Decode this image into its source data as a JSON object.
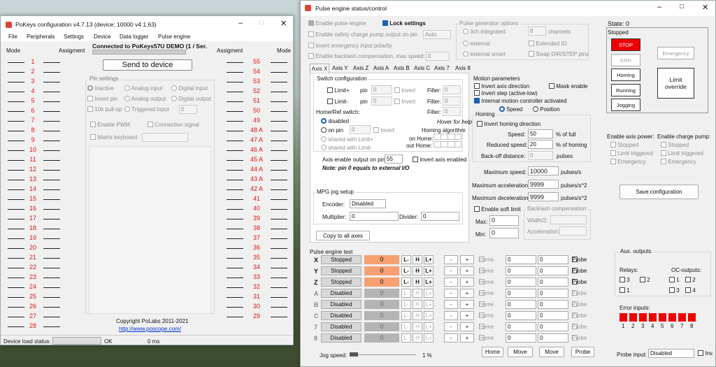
{
  "left": {
    "title": "PoKeys configuration v4.7.13 (device: 10000 v4.1.63)",
    "menu": [
      "File",
      "Peripherals",
      "Settings",
      "Device",
      "Data logger",
      "Pulse engine"
    ],
    "connected": "Connected to PoKeys57U DEMO (1 / Ser.",
    "send": "Send to device",
    "mode_l": "Mode",
    "assign_l": "Assigment",
    "assign_r": "Assigment",
    "mode_r": "Mode",
    "left_pins": [
      "1",
      "2",
      "3",
      "4",
      "5",
      "6",
      "7",
      "8",
      "9",
      "10",
      "11",
      "12",
      "13",
      "14",
      "15",
      "16",
      "17",
      "18",
      "19",
      "20",
      "21",
      "22",
      "23",
      "24",
      "25",
      "26",
      "27",
      "28"
    ],
    "right_pins": [
      "55",
      "54",
      "53",
      "52",
      "51",
      "50",
      "49",
      "48 A",
      "47 A",
      "46 A",
      "45 A",
      "44 A",
      "43 A",
      "42 A",
      "41",
      "40",
      "39",
      "38",
      "37",
      "36",
      "35",
      "34",
      "33",
      "32",
      "31",
      "30",
      "29"
    ],
    "pin_settings": "Pin settings",
    "inactive": "Inactive",
    "analog_input": "Analog input",
    "digital_input": "Digital input",
    "invert_pin": "Invert pin",
    "analog_output": "Analog output",
    "digital_output": "Digital output",
    "pullup": "10k pull-up",
    "triggered": "Triggered input",
    "trig_val": "0",
    "enable_pwm": "Enable PWM",
    "conn_signal": "Connection signal",
    "matrix": "Matrix keyboard",
    "copyright": "Copyright PoLabs 2011-2021",
    "url": "http://www.poscope.com/",
    "load_label": "Device load status:",
    "ok": "OK",
    "ms": "0 ms"
  },
  "pe": {
    "title": "Pulse engine status/control",
    "enable_pe": "Enable pulse engine",
    "lock": "Lock settings",
    "safety": "Enable safety charge pump output on pin",
    "safety_val": "Auto",
    "invert_em": "Invert emergency input polarity",
    "backlash": "Enable backlash compensation, max speed:",
    "backlash_val": "0",
    "gen_opts": "Pulse generator options",
    "int3": "3ch integrated",
    "ch_val": "8",
    "channels": "channels",
    "external": "external",
    "ext_io": "Extended IO",
    "ext_smart": "external smart",
    "swap": "Swap DIR/STEP pins",
    "tabs": [
      "Axis X",
      "Axis Y",
      "Axis Z",
      "Axis A",
      "Axis B",
      "Axis C",
      "Axis 7",
      "Axis 8"
    ],
    "switch_conf": "Switch configuration",
    "limp": "Limit+",
    "limm": "Limit-",
    "pin": "pin",
    "zero": "0",
    "invert": "Invert",
    "filter": "Filter:",
    "home_sw": "Home/Ref switch:",
    "disabled": "disabled",
    "on_pin": "on pin",
    "shared_p": "shared with Limit+",
    "shared_m": "shared with Limit-",
    "hover": "Hover for help",
    "homing_alg": "Homing algorithm",
    "on_home": "on Home:",
    "out_home": "out Home:",
    "axis_en": "Axis enable output on pin",
    "axis_en_val": "55",
    "inv_axis_en": "Invert axis enabled",
    "note": "Note: pin 0 equals to external I/O",
    "mpg": "MPG jog setup",
    "encoder": "Encoder:",
    "enc_val": "Disabled",
    "multiplier": "Multiplier:",
    "divider": "Divider:",
    "copy_axes": "Copy to all axes",
    "motion": "Motion parameters",
    "inv_dir": "Invert axis direction",
    "inv_step": "Invert step (active-low)",
    "mask": "Mask enable",
    "internal": "Internal motion controller activated",
    "speed": "Speed",
    "position": "Position",
    "homing": "Homing",
    "inv_home": "Invert homing direction",
    "h_speed": "Speed:",
    "h_speed_v": "50",
    "pct_full": "% of full",
    "h_red": "Reduced speed:",
    "h_red_v": "20",
    "pct_hom": "% of homing",
    "h_back": "Back-off distance:",
    "h_back_v": "0",
    "pulses": "pulses",
    "max_speed": "Maximum speed:",
    "max_speed_v": "10000",
    "ps": "pulses/s",
    "max_acc": "Maximum acceleration:",
    "max_acc_v": "9999",
    "ps2": "pulses/s^2",
    "max_dec": "Maximum deceleration:",
    "max_dec_v": "9999",
    "soft": "Enable soft limit",
    "max": "Max:",
    "max_v": "0",
    "min": "Min:",
    "min_v": "0",
    "backlash_c": "Backlash compensation",
    "width": "Width/2:",
    "accel": "Acceleration:",
    "state": "State: 0",
    "stopped": "Stopped",
    "stop": "STOP",
    "err": "ERR",
    "homing_b": "Homing",
    "running": "Running",
    "jogging": "Jogging",
    "emergency": "Emergency",
    "limit_ovr": "Limit override",
    "en_axis": "Enable axis power:",
    "en_charge": "Enable charge pump:",
    "limit_trig": "Limit triggered",
    "save": "Save configuration",
    "test": "Pulse engine test",
    "rows": [
      {
        "ax": "X",
        "st": "Stopped",
        "v": "0"
      },
      {
        "ax": "Y",
        "st": "Stopped",
        "v": "0"
      },
      {
        "ax": "Z",
        "st": "Stopped",
        "v": "0"
      },
      {
        "ax": "A",
        "st": "Disabled",
        "v": "0"
      },
      {
        "ax": "B",
        "st": "Disabled",
        "v": "0"
      },
      {
        "ax": "C",
        "st": "Disabled",
        "v": "0"
      },
      {
        "ax": "7",
        "st": "Disabled",
        "v": "0"
      },
      {
        "ax": "8",
        "st": "Disabled",
        "v": "0"
      }
    ],
    "lm": "L-",
    "h": "H",
    "lp": "L+",
    "minus": "-",
    "plus": "+",
    "home": "Home",
    "probe": "Probe",
    "aux": "Aux. outputs",
    "relays": "Relays:",
    "oc": "OC-outputs:",
    "one": "1",
    "two": "2",
    "three": "3",
    "four": "4",
    "err_inputs": "Error inputs:",
    "err_nums": [
      "1",
      "2",
      "3",
      "4",
      "5",
      "6",
      "7",
      "8"
    ],
    "jog": "Jog speed:",
    "jog_pct": "1 %",
    "move": "Move",
    "probe_input": "Probe input:",
    "probe_val": "Disabled",
    "inv": "Inv."
  },
  "colors": {
    "accent": "#1f5fb5",
    "pin_red": "#e01515",
    "stop": "#e00000",
    "val_orange": "#f7a072"
  }
}
